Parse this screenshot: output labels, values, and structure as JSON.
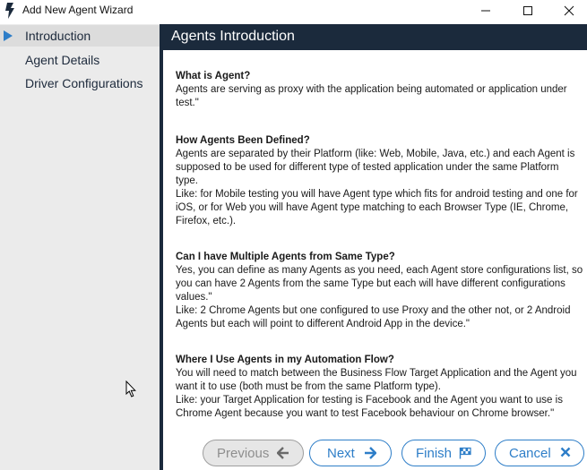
{
  "window": {
    "title": "Add New Agent Wizard",
    "app_icon": "flash-icon",
    "controls": [
      "minimize-icon",
      "maximize-icon",
      "close-icon"
    ]
  },
  "sidebar": {
    "items": [
      {
        "label": "Introduction",
        "active": true
      },
      {
        "label": "Agent Details",
        "active": false
      },
      {
        "label": "Driver Configurations",
        "active": false
      }
    ]
  },
  "main": {
    "header_title": "Agents Introduction",
    "sections": [
      {
        "question": "What is Agent?",
        "answer": "Agents are serving as proxy with the application being automated or application under test.\""
      },
      {
        "question": "How Agents Been Defined?",
        "answer": "Agents are separated by their Platform (like: Web, Mobile, Java, etc.) and each Agent is supposed to be used for different type of tested application under the same Platform type.\nLike: for Mobile testing you will have Agent type which fits for android testing and one for iOS, or for Web you will have Agent type matching to each Browser Type (IE, Chrome, Firefox, etc.)."
      },
      {
        "question": "Can I have Multiple Agents from Same Type?",
        "answer": "Yes, you can define as many Agents as you need, each Agent store configurations list, so you can have 2 Agents from the same Type but each will have different configurations values.\"\nLike: 2 Chrome Agents but one configured to use Proxy and the other not, or 2 Android Agents but each will point to different Android App in the device.\""
      },
      {
        "question": "Where I Use Agents in my Automation Flow?",
        "answer": "You will need to match between the Business Flow Target Application and the Agent you want it to use (both must be from the same Platform type).\nLike: your Target Application for testing is Facebook and the Agent you want to use is Chrome Agent because you want to test Facebook behaviour on Chrome browser.\""
      }
    ]
  },
  "footer": {
    "previous_label": "Previous",
    "next_label": "Next",
    "finish_label": "Finish",
    "cancel_label": "Cancel",
    "previous_enabled": false
  },
  "colors": {
    "header_bg": "#1b2a3c",
    "accent": "#2e7ec8",
    "sidebar_bg": "#ebebeb",
    "active_arrow": "#2e7ec8"
  }
}
